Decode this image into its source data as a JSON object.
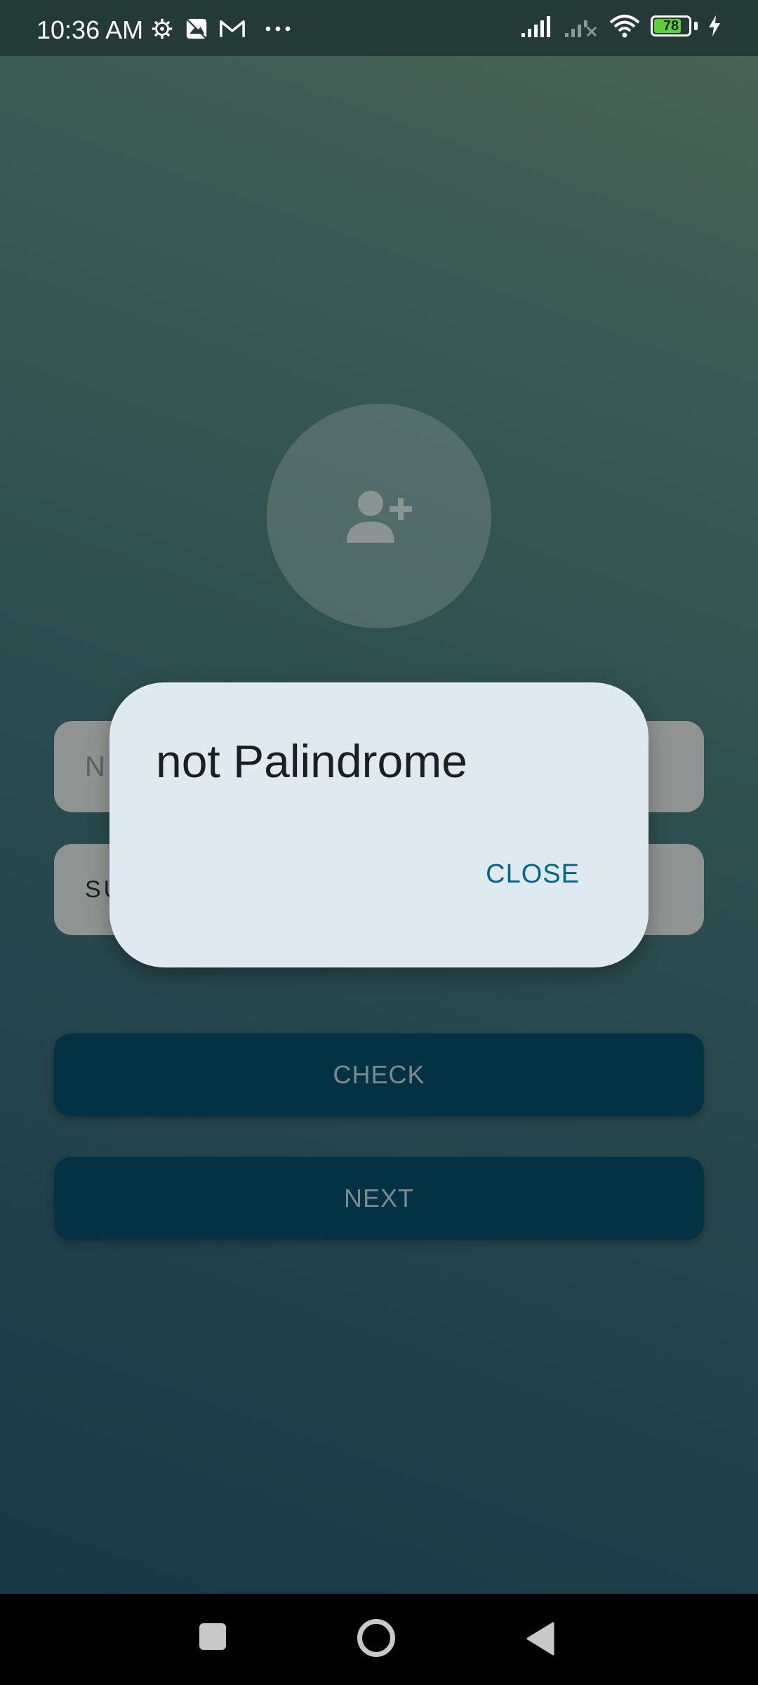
{
  "status_bar": {
    "time": "10:36 AM",
    "left_icons": [
      "gear-icon",
      "image-icon",
      "gmail-icon",
      "more-dots-icon"
    ],
    "right_icons": [
      "signal-icon",
      "signal-off-icon",
      "wifi-icon",
      "battery-icon",
      "charging-icon"
    ],
    "battery_level": "78",
    "battery_fraction": 0.78
  },
  "form": {
    "avatar_icon": "add-person-icon",
    "name_field_text": "N",
    "sentence_field_text": "SU",
    "check_label": "CHECK",
    "next_label": "NEXT"
  },
  "dialog": {
    "title": "not Palindrome",
    "close_label": "CLOSE"
  },
  "nav_bar": {
    "icons": [
      "recents-square-icon",
      "home-circle-icon",
      "back-triangle-icon"
    ]
  },
  "colors": {
    "accent": "#006688",
    "button_bg": "#023243",
    "dialog_bg": "#dfe9f0",
    "battery_green": "#5fcf3a"
  }
}
